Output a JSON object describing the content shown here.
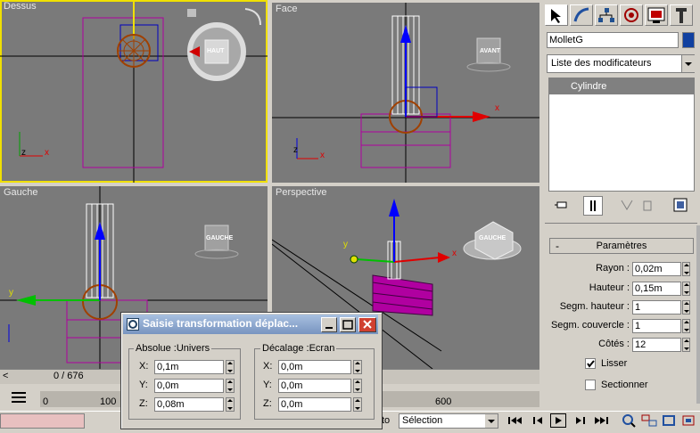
{
  "viewports": {
    "top_label": "Dessus",
    "front_label": "Face",
    "left_label": "Gauche",
    "persp_label": "Perspective",
    "cube_top": "HAUT",
    "cube_front": "AVANT",
    "cube_left": "GAUCHE",
    "cube_persp": "GAUCHE",
    "axis_x": "x",
    "axis_y": "y",
    "axis_z": "z"
  },
  "panel": {
    "object_name": "MolletG",
    "modifier_list": "Liste des modificateurs",
    "stack_item": "Cylindre",
    "rollout_title": "Paramètres",
    "params": [
      {
        "label": "Rayon :",
        "value": "0,02m"
      },
      {
        "label": "Hauteur :",
        "value": "0,15m"
      },
      {
        "label": "Segm. hauteur :",
        "value": "1"
      },
      {
        "label": "Segm. couvercle :",
        "value": "1"
      },
      {
        "label": "Côtés :",
        "value": "12"
      }
    ],
    "smooth_label": "Lisser",
    "slice_label": "Sectionner"
  },
  "timeline": {
    "frame_counter": "0 / 676",
    "prev_arrow": "<",
    "tick_0": "0",
    "tick_100": "100",
    "tick_600": "600"
  },
  "bottom": {
    "auto_label": "to",
    "selection_value": "Sélection"
  },
  "dialog": {
    "title": "Saisie transformation déplac...",
    "abs_group": "Absolue :Univers",
    "off_group": "Décalage :Ecran",
    "abs": [
      {
        "axis": "X:",
        "value": "0,1m"
      },
      {
        "axis": "Y:",
        "value": "0,0m"
      },
      {
        "axis": "Z:",
        "value": "0,08m"
      }
    ],
    "off": [
      {
        "axis": "X:",
        "value": "0,0m"
      },
      {
        "axis": "Y:",
        "value": "0,0m"
      },
      {
        "axis": "Z:",
        "value": "0,0m"
      }
    ]
  },
  "colors": {
    "viewport_bg": "#7a7a7a",
    "active_border": "#f0e000",
    "selection_blue": "#5a5a8a",
    "magenta": "#b000a0"
  }
}
